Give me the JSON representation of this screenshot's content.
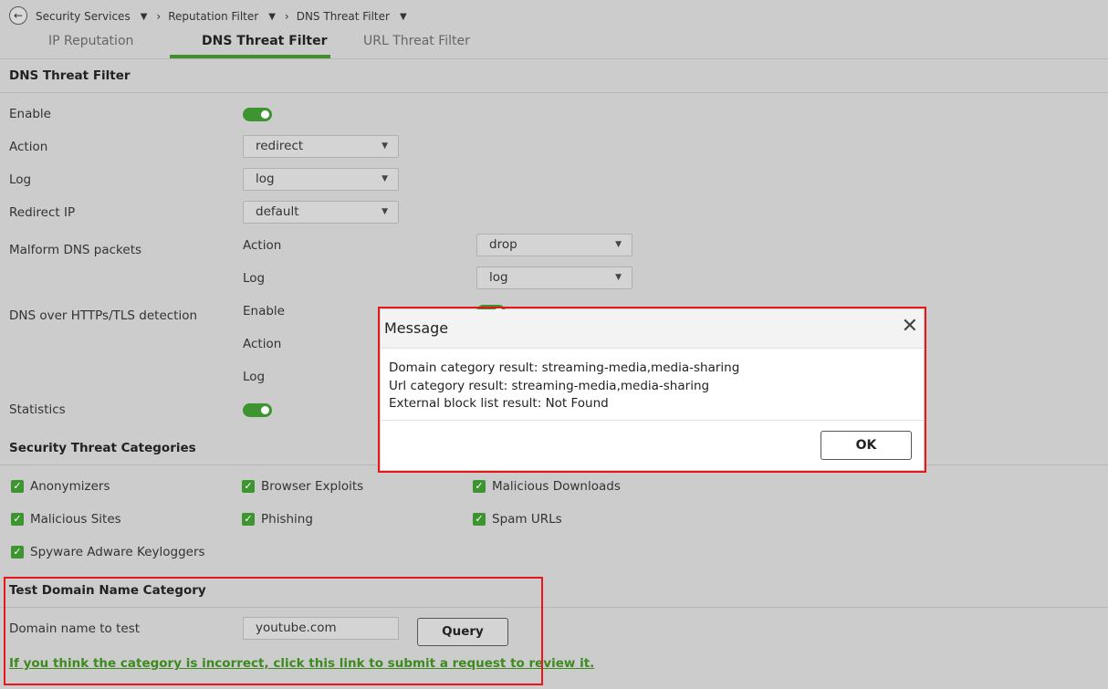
{
  "breadcrumb": {
    "items": [
      "Security Services",
      "Reputation Filter",
      "DNS Threat Filter"
    ]
  },
  "tabs": [
    "IP Reputation",
    "DNS Threat Filter",
    "URL Threat Filter"
  ],
  "section_dns": {
    "title": "DNS Threat Filter",
    "enable_label": "Enable",
    "enable_on": true,
    "action_label": "Action",
    "action_value": "redirect",
    "log_label": "Log",
    "log_value": "log",
    "redirect_ip_label": "Redirect IP",
    "redirect_ip_value": "default",
    "malform_label": "Malform DNS packets",
    "malform_action_label": "Action",
    "malform_action_value": "drop",
    "malform_log_label": "Log",
    "malform_log_value": "log",
    "doh_label": "DNS over HTTPs/TLS detection",
    "doh_enable_label": "Enable",
    "doh_action_label": "Action",
    "doh_log_label": "Log",
    "statistics_label": "Statistics",
    "statistics_on": true
  },
  "categories": {
    "title": "Security Threat Categories",
    "items": [
      "Anonymizers",
      "Browser Exploits",
      "Malicious Downloads",
      "Malicious Sites",
      "Phishing",
      "Spam URLs",
      "Spyware Adware Keyloggers"
    ]
  },
  "test_domain": {
    "title": "Test Domain Name Category",
    "label": "Domain name to test",
    "value": "youtube.com",
    "query_button": "Query",
    "review_link": "If you think the category is incorrect, click this link to submit a request to review it."
  },
  "modal": {
    "title": "Message",
    "lines": [
      "Domain category result: streaming-media,media-sharing",
      "Url category result: streaming-media,media-sharing",
      "External block list result: Not Found"
    ],
    "ok_button": "OK"
  },
  "colors": {
    "accent_green": "#3d9430",
    "highlight_red": "#e8151b",
    "page_bg": "#cccccc"
  },
  "icons": [
    "back-arrow-icon",
    "caret-down-icon",
    "chevron-right-icon",
    "toggle-switch",
    "checkbox-checked-icon",
    "close-icon"
  ]
}
